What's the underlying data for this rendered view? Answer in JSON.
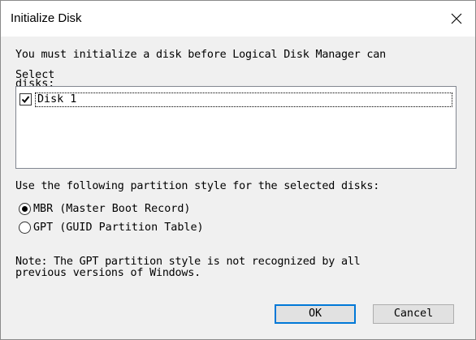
{
  "window": {
    "title": "Initialize Disk"
  },
  "message": "You must initialize a disk before Logical Disk Manager can",
  "select_label": "Select disks:",
  "disks": [
    {
      "label": "Disk 1",
      "checked": true
    }
  ],
  "partition_style_label": "Use the following partition style for the selected disks:",
  "options": {
    "mbr": "MBR (Master Boot Record)",
    "gpt": "GPT (GUID Partition Table)",
    "selected": "mbr"
  },
  "note": "Note: The GPT partition style is not recognized by all\nprevious versions of Windows.",
  "buttons": {
    "ok": "OK",
    "cancel": "Cancel"
  },
  "icons": {
    "close": "close-icon",
    "checkbox": "checkmark-icon"
  }
}
